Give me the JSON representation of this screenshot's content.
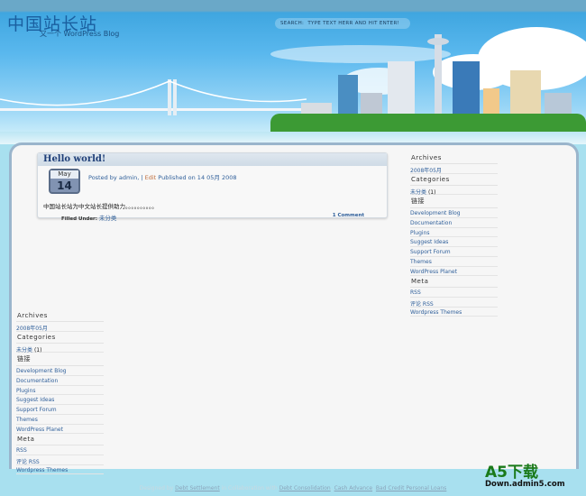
{
  "header": {
    "title": "中国站长站",
    "description": "又一个 WordPress Blog",
    "search_label": "SEARCH:",
    "search_placeholder": "TYPE TEXT HERR AND HIT ENTER!"
  },
  "post": {
    "title": "Hello world!",
    "month": "May",
    "day": "14",
    "posted_by": "Posted by admin, |",
    "edit": "Edit",
    "published": "Published on 14 05月 2008",
    "excerpt": "中国站长站为中文站长提供助力。。。。。。。。。。",
    "filed_label": "Filled Under:",
    "category": "未分类",
    "comments": "1 Comment"
  },
  "sidebar": {
    "archives_title": "Archives",
    "archives": [
      "2008年05月"
    ],
    "categories_title": "Categories",
    "category": "未分类",
    "category_count": "(1)",
    "links_title": "链接",
    "links": [
      "Development Blog",
      "Documentation",
      "Plugins",
      "Suggest Ideas",
      "Support Forum",
      "Themes",
      "WordPress Planet"
    ],
    "meta_title": "Meta",
    "meta": [
      "RSS",
      "评论 RSS",
      "Wordpress Themes"
    ]
  },
  "footer": {
    "designed_by": "Designed by",
    "link1": "Debt Settlement",
    "collab": "in Collaboration with",
    "link2": "Debt Consolidation",
    "link3": "Cash Advance",
    "link4": "Bad Credit Personal Loans"
  },
  "watermark": {
    "brand": "A5下载",
    "domain": "Down.admin5.com"
  }
}
